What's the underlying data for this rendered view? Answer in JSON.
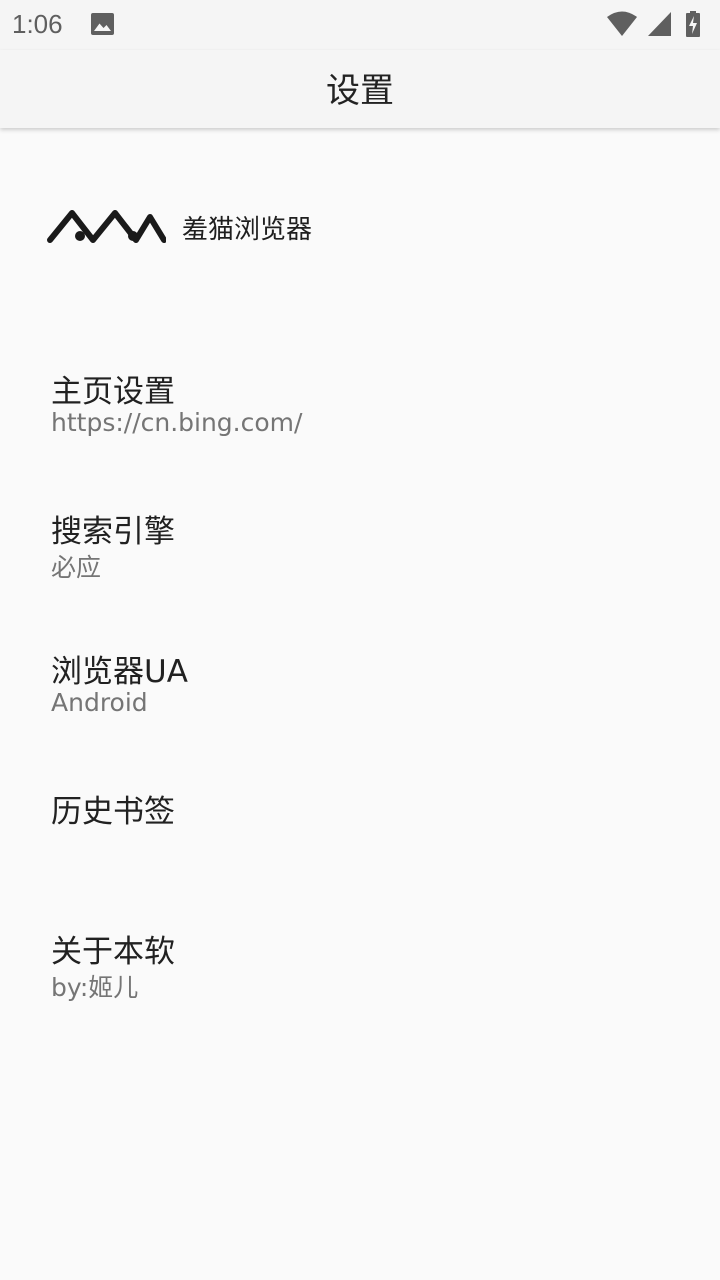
{
  "status_bar": {
    "time": "1:06",
    "icons": [
      "gallery-icon",
      "wifi-icon",
      "cell-signal-icon",
      "battery-charging-icon"
    ]
  },
  "app_bar": {
    "title": "设置"
  },
  "brand": {
    "name": "羞猫浏览器",
    "logo_icon": "cat-logo-icon"
  },
  "settings": {
    "homepage": {
      "title": "主页设置",
      "summary": "https://cn.bing.com/"
    },
    "search_engine": {
      "title": "搜索引擎",
      "summary": "必应"
    },
    "browser_ua": {
      "title": "浏览器UA",
      "summary": "Android"
    },
    "history_bookmarks": {
      "title": "历史书签"
    },
    "about": {
      "title": "关于本软",
      "summary": "by:姬儿"
    }
  },
  "colors": {
    "background": "#fafafa",
    "app_bar": "#f5f5f5",
    "title_text": "#212121",
    "summary_text": "#757575",
    "status_icons": "#5f5f5f"
  }
}
